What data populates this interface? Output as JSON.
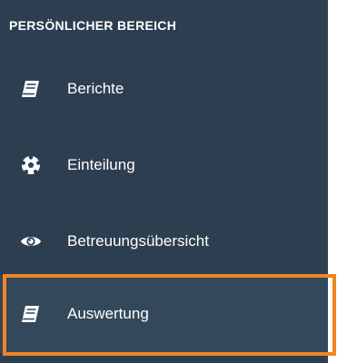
{
  "sidebar": {
    "section_title": "PERSÖNLICHER BEREICH",
    "items": [
      {
        "label": "Berichte",
        "icon": "book-icon"
      },
      {
        "label": "Einteilung",
        "icon": "soccer-ball-icon"
      },
      {
        "label": "Betreuungsübersicht",
        "icon": "eye-icon"
      },
      {
        "label": "Auswertung",
        "icon": "book-icon",
        "highlighted": true
      }
    ]
  },
  "colors": {
    "sidebar_bg": "#2d3e50",
    "highlight_bg": "#34485c",
    "highlight_border": "#f08524",
    "text": "#ffffff"
  }
}
